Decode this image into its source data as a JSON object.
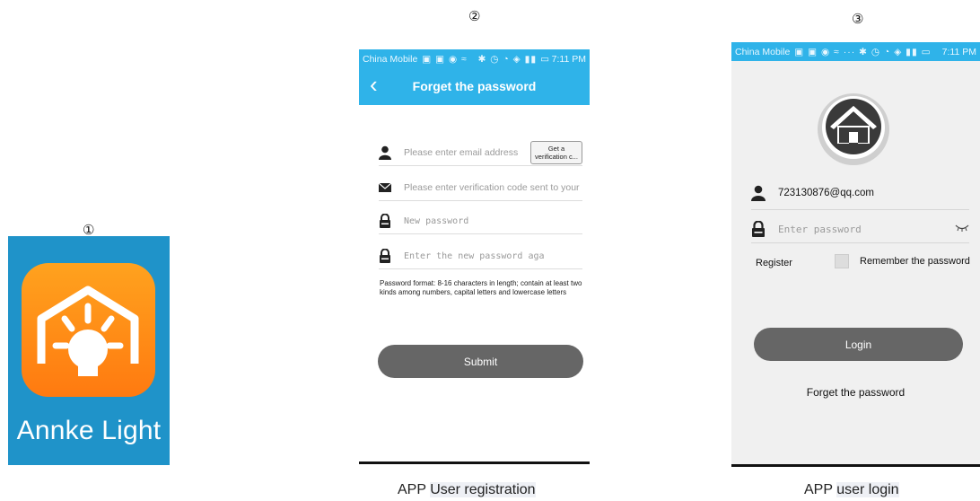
{
  "markers": {
    "one": "①",
    "two": "②",
    "three": "③"
  },
  "app_icon": {
    "label": "Annke Light",
    "icon": "lamp-house-icon"
  },
  "forget_screen": {
    "status": {
      "carrier": "China Mobile",
      "time": "7:11 PM"
    },
    "title": "Forget the password",
    "back_icon": "chevron-left-icon",
    "email_placeholder": "Please enter email address",
    "get_code_button": "Get a verification c...",
    "code_placeholder": "Please enter verification code sent to your",
    "new_password_placeholder": "New password",
    "confirm_password_placeholder": "Enter the new password aga",
    "hint": "Password format: 8-16 characters in length; contain at least two kinds among numbers, capital letters and lowercase letters",
    "submit_label": "Submit"
  },
  "login_screen": {
    "status": {
      "carrier": "China Mobile",
      "time": "7:11 PM"
    },
    "account_value": "723130876@qq.com",
    "password_placeholder": "Enter password",
    "register_label": "Register",
    "remember_label": "Remember the password",
    "remember_checked": false,
    "login_label": "Login",
    "forget_label": "Forget the password"
  },
  "captions": {
    "registration": {
      "prefix": "APP",
      "highlight": "User registration"
    },
    "login": {
      "prefix": "APP",
      "highlight": "user login"
    }
  },
  "colors": {
    "accent": "#2fb3e9",
    "button": "#666666",
    "icon_orange": "#ff8a14"
  }
}
